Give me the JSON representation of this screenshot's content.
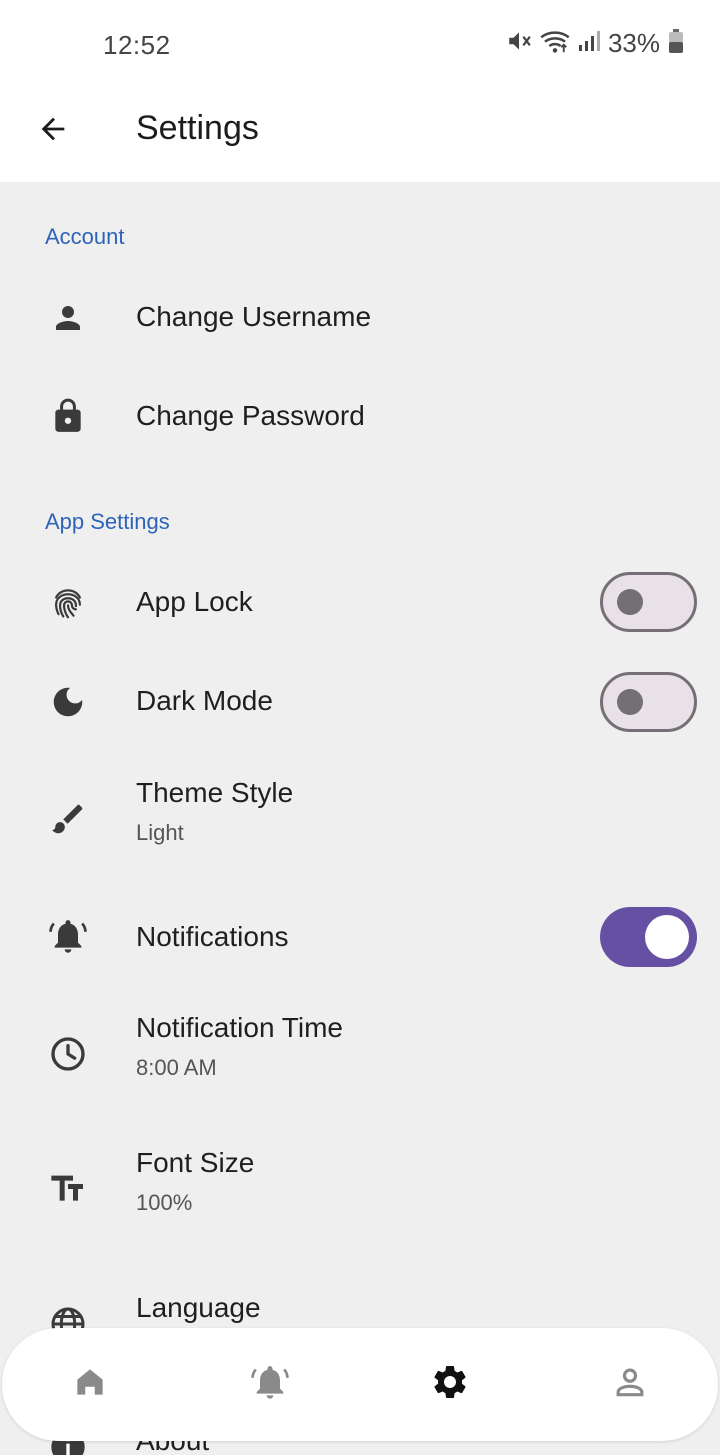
{
  "status_bar": {
    "time": "12:52",
    "battery_percent": "33%",
    "icons": [
      "mute-icon",
      "wifi-icon",
      "signal-icon",
      "battery-icon"
    ]
  },
  "app_bar": {
    "title": "Settings",
    "back_icon": "arrow-back-icon"
  },
  "sections": {
    "account": {
      "header": "Account",
      "items": [
        {
          "label": "Change Username",
          "icon": "person-icon"
        },
        {
          "label": "Change Password",
          "icon": "lock-icon"
        }
      ]
    },
    "app_settings": {
      "header": "App Settings",
      "items": [
        {
          "label": "App Lock",
          "icon": "fingerprint-icon",
          "toggle": false
        },
        {
          "label": "Dark Mode",
          "icon": "moon-icon",
          "toggle": false
        },
        {
          "label": "Theme Style",
          "value": "Light",
          "icon": "brush-icon"
        },
        {
          "label": "Notifications",
          "icon": "bell-ringing-icon",
          "toggle": true
        },
        {
          "label": "Notification Time",
          "value": "8:00 AM",
          "icon": "clock-icon"
        },
        {
          "label": "Font Size",
          "value": "100%",
          "icon": "text-size-icon"
        },
        {
          "label": "Language",
          "icon": "globe-icon"
        },
        {
          "label": "About",
          "icon": "info-icon"
        }
      ]
    }
  },
  "bottom_nav": {
    "items": [
      {
        "icon": "home-icon",
        "active": false
      },
      {
        "icon": "bell-ringing-icon",
        "active": false
      },
      {
        "icon": "gear-icon",
        "active": true
      },
      {
        "icon": "person-outline-icon",
        "active": false
      }
    ]
  },
  "colors": {
    "accent": "#6650a4",
    "section_header": "#2e64b8",
    "background": "#efefef",
    "surface": "#ffffff"
  }
}
